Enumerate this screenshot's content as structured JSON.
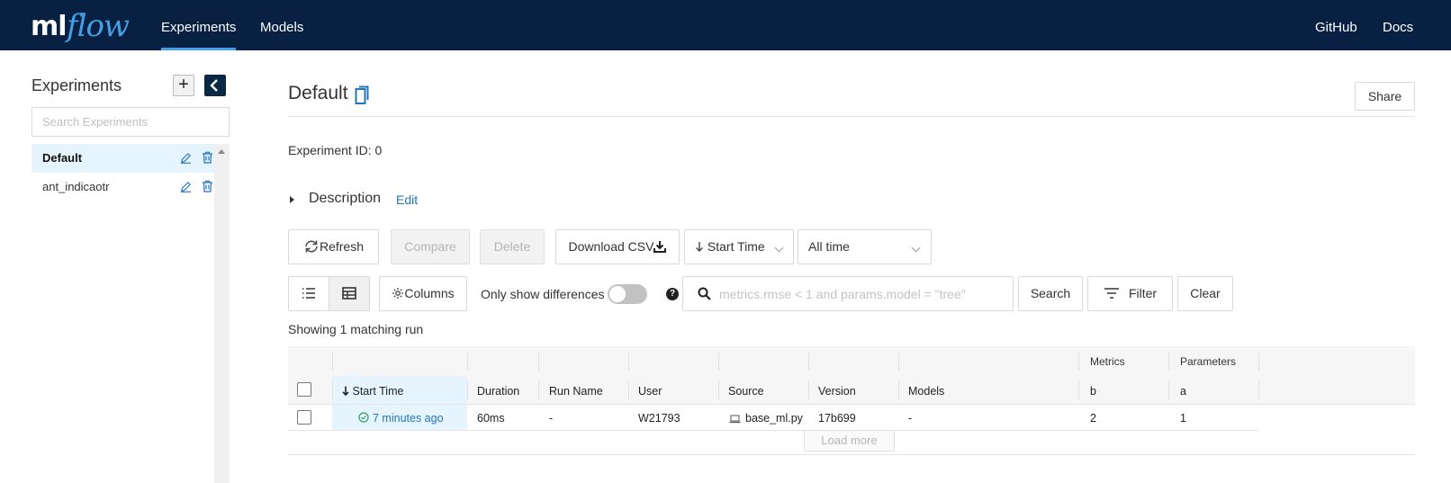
{
  "header": {
    "logo_ml": "ml",
    "logo_flow": "flow",
    "nav": [
      {
        "label": "Experiments"
      },
      {
        "label": "Models"
      }
    ],
    "links": [
      {
        "label": "GitHub"
      },
      {
        "label": "Docs"
      }
    ],
    "accent": "#43a0e6",
    "background": "#082142"
  },
  "sidebar": {
    "title": "Experiments",
    "add_label": "+",
    "search_placeholder": "Search Experiments",
    "items": [
      {
        "label": "Default",
        "active": true
      },
      {
        "label": "ant_indicaotr",
        "active": false
      }
    ]
  },
  "main": {
    "title": "Default",
    "share_label": "Share",
    "experiment_id_label": "Experiment ID:",
    "experiment_id": "0",
    "description_label": "Description",
    "description_edit": "Edit",
    "toolbar": {
      "refresh": "Refresh",
      "compare": "Compare",
      "delete": "Delete",
      "download_csv": "Download CSV",
      "sort_select": "Start Time",
      "time_select": "All time",
      "columns": "Columns",
      "only_diff": "Only show differences",
      "search_placeholder": "metrics.rmse < 1 and params.model = \"tree\"",
      "search": "Search",
      "filter": "Filter",
      "clear": "Clear"
    },
    "match_text": "Showing 1 matching run",
    "table": {
      "groups": {
        "metrics": "Metrics",
        "parameters": "Parameters"
      },
      "columns": [
        "Start Time",
        "Duration",
        "Run Name",
        "User",
        "Source",
        "Version",
        "Models",
        "b",
        "a"
      ],
      "rows": [
        {
          "start_time": "7 minutes ago",
          "duration": "60ms",
          "run_name": "-",
          "user": "W21793",
          "source": "base_ml.py",
          "version": "17b699",
          "models": "-",
          "b": "2",
          "a": "1"
        }
      ],
      "load_more": "Load more"
    }
  }
}
